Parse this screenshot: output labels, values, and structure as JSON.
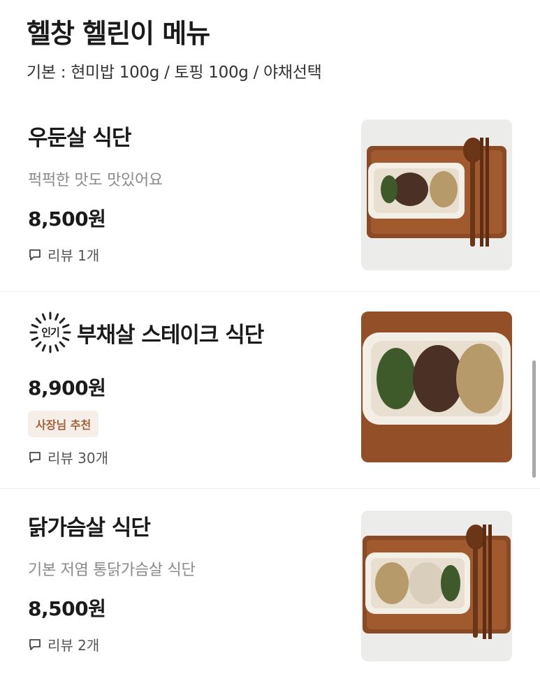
{
  "header": {
    "title": "헬창 헬린이 메뉴",
    "subtitle": "기본 : 현미밥 100g / 토핑 100g / 야채선택"
  },
  "items": [
    {
      "name": "우둔살 식단",
      "description": "퍽퍽한 맛도 맛있어요",
      "price": "8,500원",
      "review": "리뷰 1개"
    },
    {
      "name": "부채살 스테이크 식단",
      "popular_label": "인기",
      "price": "8,900원",
      "owner_badge": "사장님 추천",
      "review": "리뷰 30개"
    },
    {
      "name": "닭가슴살 식단",
      "description": "기본 저염 통닭가슴살 식단",
      "price": "8,500원",
      "review": "리뷰 2개"
    }
  ],
  "colors": {
    "badge_bg": "#f6eee8",
    "badge_text": "#a2613b",
    "tray": "#8a4a25"
  },
  "icons": {
    "review": "speech-bubble-icon",
    "popular": "sunburst-badge-icon"
  }
}
